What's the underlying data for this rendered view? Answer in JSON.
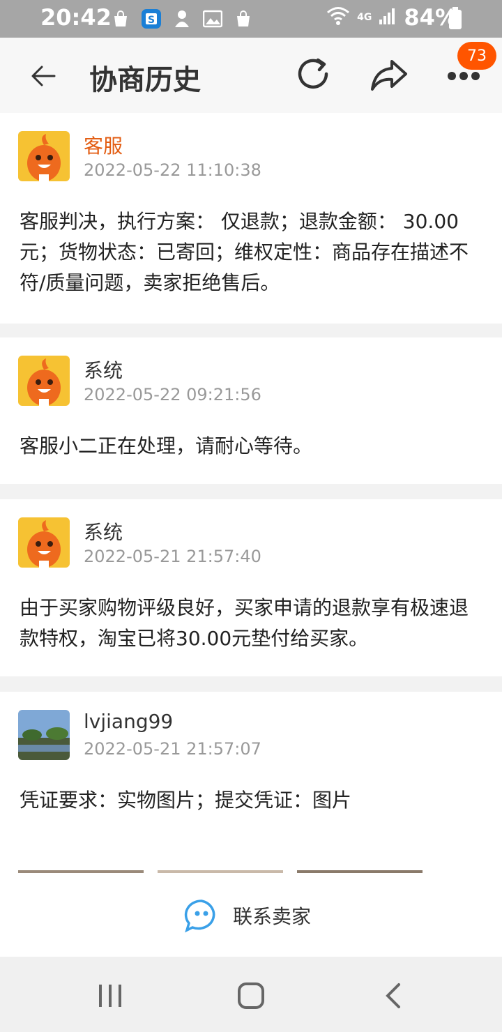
{
  "status_bar": {
    "time": "20:42",
    "network": "4G",
    "battery": "84%"
  },
  "header": {
    "title": "协商历史",
    "badge_count": "73"
  },
  "records": [
    {
      "name": "客服",
      "time": "2022-05-22 11:10:38",
      "text": "客服判决，执行方案： 仅退款；退款金额： 30.00元；货物状态：已寄回；维权定性：商品存在描述不符/质量问题，卖家拒绝售后。",
      "avatar": "mascot-avatar"
    },
    {
      "name": "系统",
      "time": "2022-05-22 09:21:56",
      "text": "客服小二正在处理，请耐心等待。",
      "avatar": "mascot-avatar"
    },
    {
      "name": "系统",
      "time": "2022-05-21 21:57:40",
      "text": "由于买家购物评级良好，买家申请的退款享有极速退款特权，淘宝已将30.00元垫付给买家。",
      "avatar": "mascot-avatar"
    },
    {
      "name": "lvjiang99",
      "time": "2022-05-21 21:57:07",
      "text": "凭证要求：实物图片；提交凭证：图片",
      "avatar": "landscape-avatar"
    }
  ],
  "contact": {
    "label": "联系卖家"
  },
  "colors": {
    "accent": "#ff5500",
    "service_name": "#e35d12"
  }
}
